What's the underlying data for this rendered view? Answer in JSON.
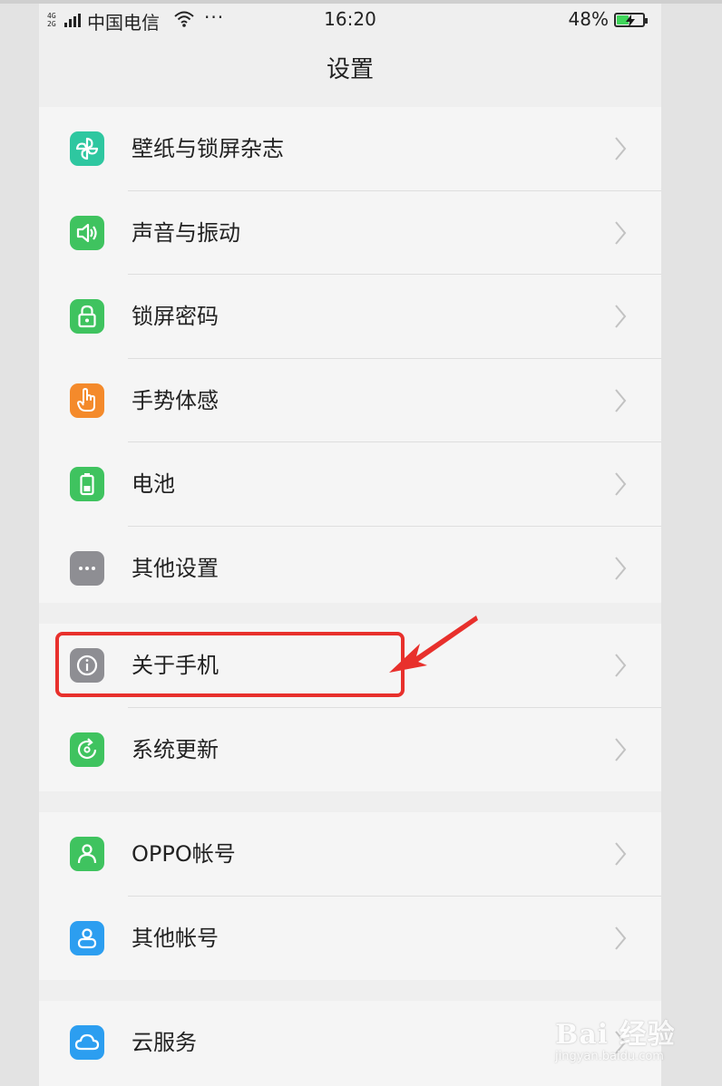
{
  "status_bar": {
    "signal_type": "4G\n2G",
    "carrier": "中国电信",
    "more": "···",
    "time": "16:20",
    "battery_percent": "48%",
    "battery_level": 0.48,
    "battery_charging": true
  },
  "header": {
    "title": "设置"
  },
  "groups": [
    {
      "items": [
        {
          "label": "壁纸与锁屏杂志",
          "icon": "pinwheel-icon",
          "color": "#2ec7a0"
        },
        {
          "label": "声音与振动",
          "icon": "speaker-icon",
          "color": "#3fc35f"
        },
        {
          "label": "锁屏密码",
          "icon": "lock-icon",
          "color": "#3fc35f"
        },
        {
          "label": "手势体感",
          "icon": "hand-gesture-icon",
          "color": "#f48a2b"
        },
        {
          "label": "电池",
          "icon": "battery-icon",
          "color": "#3fc35f"
        },
        {
          "label": "其他设置",
          "icon": "more-dots-icon",
          "color": "#8e8e93"
        }
      ]
    },
    {
      "items": [
        {
          "label": "关于手机",
          "icon": "info-icon",
          "color": "#8e8e93"
        },
        {
          "label": "系统更新",
          "icon": "update-icon",
          "color": "#3fc35f"
        }
      ]
    },
    {
      "items": [
        {
          "label": "OPPO帐号",
          "icon": "user-icon",
          "color": "#3fc35f"
        },
        {
          "label": "其他帐号",
          "icon": "user-outline-icon",
          "color": "#2c9ef0"
        }
      ]
    },
    {
      "items": [
        {
          "label": "云服务",
          "icon": "cloud-icon",
          "color": "#2c9ef0"
        }
      ]
    }
  ],
  "annotation": {
    "highlight_color": "#e8302c",
    "highlighted_item": "关于手机"
  },
  "watermark": {
    "brand": "Bai 经验",
    "url": "jingyan.baidu.com"
  }
}
